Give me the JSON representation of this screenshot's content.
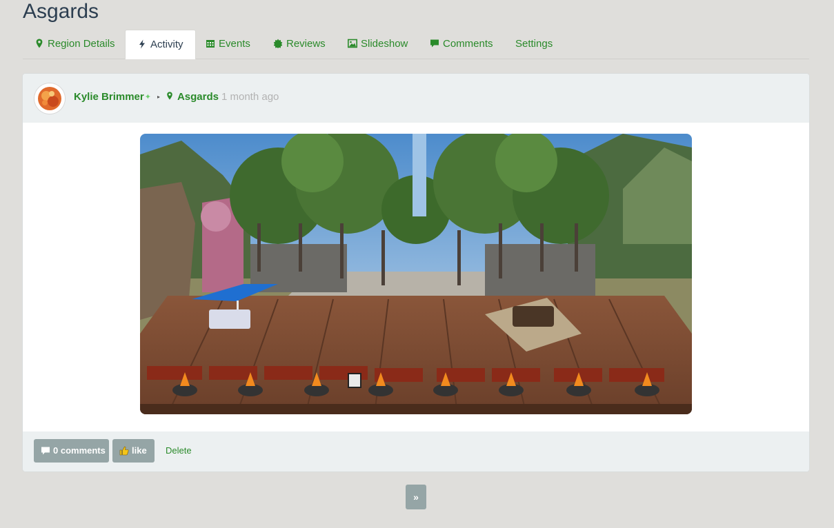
{
  "page": {
    "title": "Asgards"
  },
  "tabs": [
    {
      "label": "Region Details",
      "icon": "map-marker-icon"
    },
    {
      "label": "Activity",
      "icon": "bolt-icon",
      "active": true
    },
    {
      "label": "Events",
      "icon": "calendar-icon"
    },
    {
      "label": "Reviews",
      "icon": "badge-icon"
    },
    {
      "label": "Slideshow",
      "icon": "image-icon"
    },
    {
      "label": "Comments",
      "icon": "comment-icon"
    },
    {
      "label": "Settings"
    }
  ],
  "post": {
    "user": "Kylie Brimmer",
    "user_badge": "✦",
    "separator": "▸",
    "region": "Asgards",
    "time": "1 month ago",
    "comments_label": "0 comments",
    "like_label": "like",
    "delete_label": "Delete"
  },
  "pagination": {
    "next_label": "»"
  },
  "colors": {
    "link": "#2a8a2a",
    "button": "#95a5a6",
    "panel": "#ecf0f1",
    "background": "#dfdedb"
  }
}
